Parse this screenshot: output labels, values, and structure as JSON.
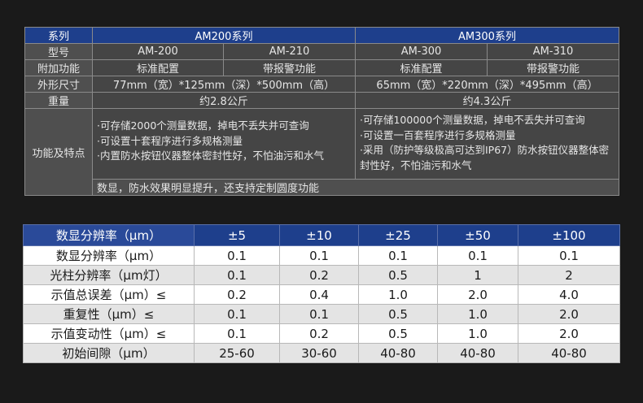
{
  "spec": {
    "series_label": "系列",
    "series": [
      "AM200系列",
      "AM300系列"
    ],
    "model_label": "型号",
    "models": [
      "AM-200",
      "AM-210",
      "AM-300",
      "AM-310"
    ],
    "addon_label": "附加功能",
    "addons": [
      "标准配置",
      "带报警功能",
      "标准配置",
      "带报警功能"
    ],
    "size_label": "外形尺寸",
    "sizes": [
      "77mm（宽）*125mm（深）*500mm（高）",
      "65mm（宽）*220mm（深）*495mm（高）"
    ],
    "weight_label": "重量",
    "weights": [
      "约2.8公斤",
      "约4.3公斤"
    ],
    "features_label": "功能及特点",
    "features_200": [
      "·可存储2000个测量数据，掉电不丢失并可查询",
      "·可设置十套程序进行多规格测量",
      "·内置防水按钮仪器整体密封性好，不怕油污和水气"
    ],
    "features_300": [
      "·可存储100000个测量数据，掉电不丢失并可查询",
      "·可设置一百套程序进行多规格测量",
      "·采用（防护等级极高可达到IP67）防水按钮仪器整体密封性好，不怕油污和水气"
    ],
    "common_note": "数显，防水效果明显提升，还支持定制圆度功能"
  },
  "resolution": {
    "header": [
      "数显分辨率（μm）",
      "±5",
      "±10",
      "±25",
      "±50",
      "±100"
    ],
    "rows": [
      {
        "label": "数显分辨率（μm）",
        "values": [
          "0.1",
          "0.1",
          "0.1",
          "0.1",
          "0.1"
        ]
      },
      {
        "label": "光柱分辨率（μm灯）",
        "values": [
          "0.1",
          "0.2",
          "0.5",
          "1",
          "2"
        ]
      },
      {
        "label": "示值总误差（μm）≤",
        "values": [
          "0.2",
          "0.4",
          "1.0",
          "2.0",
          "4.0"
        ]
      },
      {
        "label": "重复性（μm）≤",
        "values": [
          "0.1",
          "0.1",
          "0.5",
          "1.0",
          "2.0"
        ]
      },
      {
        "label": "示值变动性（μm）≤",
        "values": [
          "0.1",
          "0.2",
          "0.5",
          "1.0",
          "2.0"
        ]
      },
      {
        "label": "初始间隙（μm）",
        "values": [
          "25-60",
          "30-60",
          "40-80",
          "40-80",
          "40-80"
        ]
      }
    ]
  },
  "colors": {
    "background": "#1a1a1a",
    "header_blue": "#1e3f8c",
    "cell_gray": "#454545"
  }
}
